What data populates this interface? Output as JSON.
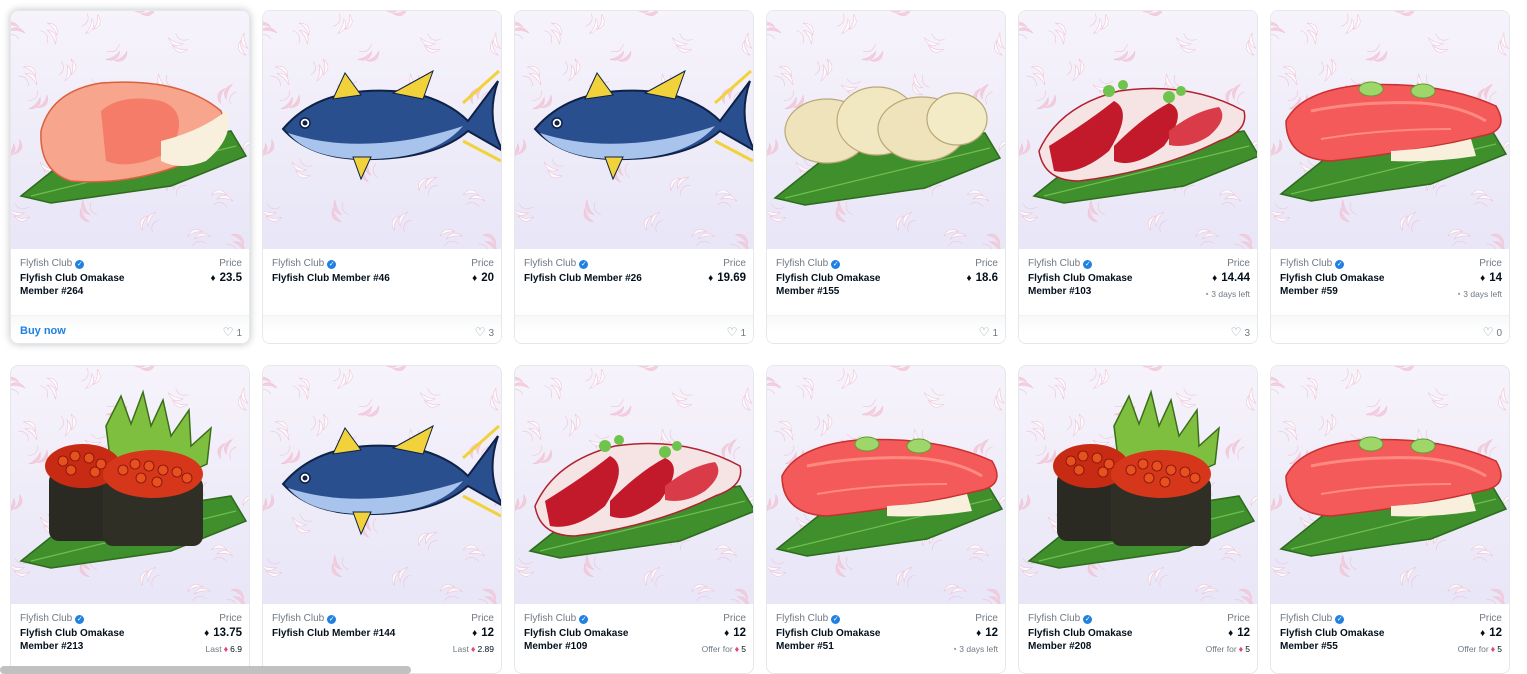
{
  "cards": [
    {
      "collection": "Flyfish Club",
      "name": "Flyfish Club Omakase Member #264",
      "price_label": "Price",
      "price": "23.5",
      "sub_text": "",
      "sub_value": "",
      "action": "Buy now",
      "likes": "1",
      "art": "salmon"
    },
    {
      "collection": "Flyfish Club",
      "name": "Flyfish Club Member #46",
      "price_label": "Price",
      "price": "20",
      "sub_text": "",
      "sub_value": "",
      "action": "",
      "likes": "3",
      "art": "tuna"
    },
    {
      "collection": "Flyfish Club",
      "name": "Flyfish Club Member #26",
      "price_label": "Price",
      "price": "19.69",
      "sub_text": "",
      "sub_value": "",
      "action": "",
      "likes": "1",
      "art": "tuna"
    },
    {
      "collection": "Flyfish Club",
      "name": "Flyfish Club Omakase Member #155",
      "price_label": "Price",
      "price": "18.6",
      "sub_text": "",
      "sub_value": "",
      "action": "",
      "likes": "1",
      "art": "scallop"
    },
    {
      "collection": "Flyfish Club",
      "name": "Flyfish Club Omakase Member #103",
      "price_label": "Price",
      "price": "14.44",
      "sub_text": "3 days left",
      "sub_value": "",
      "action": "",
      "likes": "3",
      "art": "yellowtail"
    },
    {
      "collection": "Flyfish Club",
      "name": "Flyfish Club Omakase Member #59",
      "price_label": "Price",
      "price": "14",
      "sub_text": "3 days left",
      "sub_value": "",
      "action": "",
      "likes": "0",
      "art": "otoro"
    },
    {
      "collection": "Flyfish Club",
      "name": "Flyfish Club Omakase Member #213",
      "price_label": "Price",
      "price": "13.75",
      "sub_text": "Last",
      "sub_value": "6.9",
      "action": "",
      "likes": "",
      "art": "ikura"
    },
    {
      "collection": "Flyfish Club",
      "name": "Flyfish Club Member #144",
      "price_label": "Price",
      "price": "12",
      "sub_text": "Last",
      "sub_value": "2.89",
      "action": "",
      "likes": "",
      "art": "tuna"
    },
    {
      "collection": "Flyfish Club",
      "name": "Flyfish Club Omakase Member #109",
      "price_label": "Price",
      "price": "12",
      "sub_text": "Offer for",
      "sub_value": "5",
      "action": "",
      "likes": "",
      "art": "yellowtail"
    },
    {
      "collection": "Flyfish Club",
      "name": "Flyfish Club Omakase Member #51",
      "price_label": "Price",
      "price": "12",
      "sub_text": "3 days left",
      "sub_value": "",
      "action": "",
      "likes": "",
      "art": "otoro"
    },
    {
      "collection": "Flyfish Club",
      "name": "Flyfish Club Omakase Member #208",
      "price_label": "Price",
      "price": "12",
      "sub_text": "Offer for",
      "sub_value": "5",
      "action": "",
      "likes": "",
      "art": "ikura"
    },
    {
      "collection": "Flyfish Club",
      "name": "Flyfish Club Omakase Member #55",
      "price_label": "Price",
      "price": "12",
      "sub_text": "Offer for",
      "sub_value": "5",
      "action": "",
      "likes": "",
      "art": "otoro"
    }
  ],
  "colors": {
    "accent": "#2081e2",
    "text_primary": "#04111d",
    "text_secondary": "#707a83",
    "eth_pink": "#e8467c"
  }
}
